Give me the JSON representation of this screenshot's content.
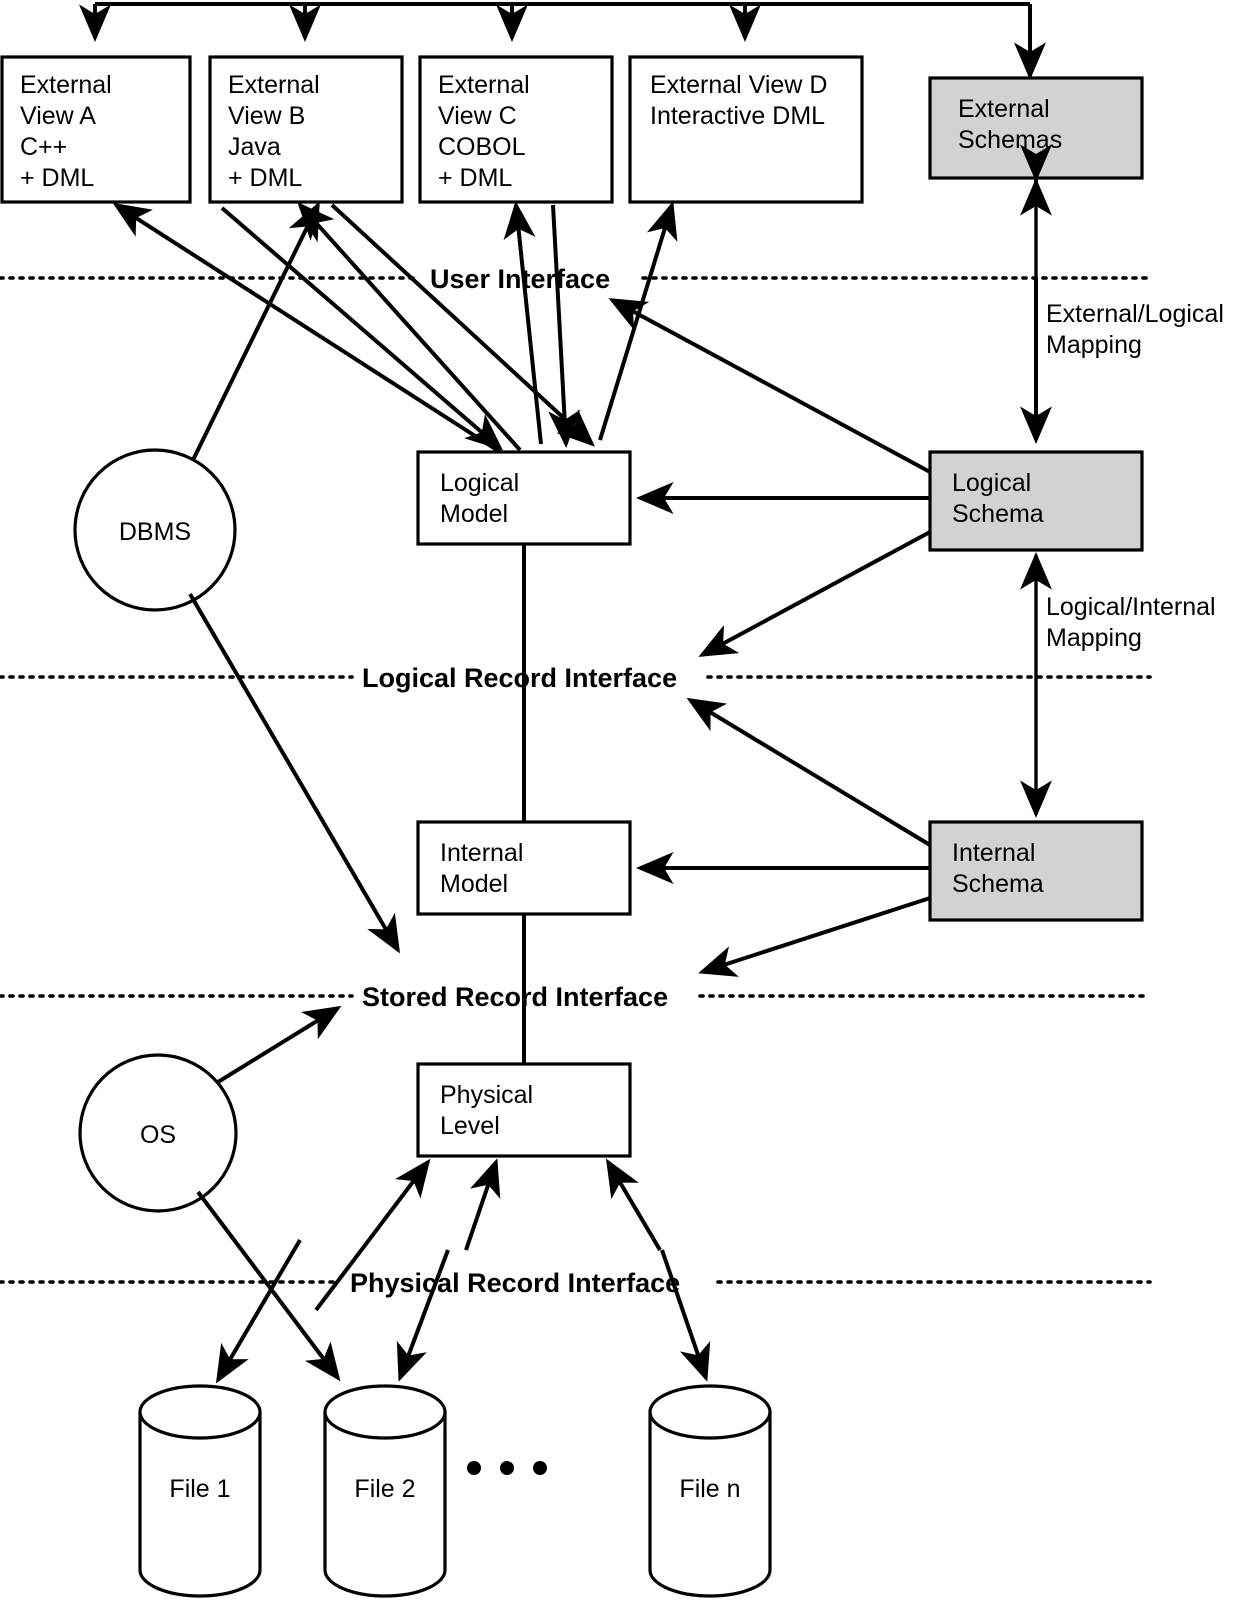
{
  "diagram": {
    "title": "Three-Level Database Architecture (ANSI/SPARC)",
    "colors": {
      "schema_fill": "#d2d2d2",
      "node_fill": "#ffffff",
      "stroke": "#000000"
    },
    "external_views": [
      {
        "id": "view-a",
        "lines": [
          "External",
          "View A",
          "C++",
          "+ DML"
        ]
      },
      {
        "id": "view-b",
        "lines": [
          "External",
          "View B",
          "Java",
          "+ DML"
        ]
      },
      {
        "id": "view-c",
        "lines": [
          "External",
          "View C",
          "COBOL",
          "+ DML"
        ]
      },
      {
        "id": "view-d",
        "lines": [
          "External View D",
          "Interactive DML"
        ]
      }
    ],
    "schemas": [
      {
        "id": "external-schemas",
        "lines": [
          "External",
          "Schemas"
        ]
      },
      {
        "id": "logical-schema",
        "lines": [
          "Logical",
          "Schema"
        ]
      },
      {
        "id": "internal-schema",
        "lines": [
          "Internal",
          "Schema"
        ]
      }
    ],
    "models": [
      {
        "id": "logical-model",
        "lines": [
          "Logical",
          "Model"
        ]
      },
      {
        "id": "internal-model",
        "lines": [
          "Internal",
          "Model"
        ]
      },
      {
        "id": "physical-level",
        "lines": [
          "Physical",
          "Level"
        ]
      }
    ],
    "actors": [
      {
        "id": "dbms",
        "label": "DBMS"
      },
      {
        "id": "os",
        "label": "OS"
      }
    ],
    "interfaces": [
      {
        "id": "user-interface",
        "label": "User Interface"
      },
      {
        "id": "logical-record-interface",
        "label": "Logical Record Interface"
      },
      {
        "id": "stored-record-interface",
        "label": "Stored Record Interface"
      },
      {
        "id": "physical-record-interface",
        "label": "Physical Record Interface"
      }
    ],
    "mappings": [
      {
        "id": "external-logical-mapping",
        "lines": [
          "External/Logical",
          "Mapping"
        ]
      },
      {
        "id": "logical-internal-mapping",
        "lines": [
          "Logical/Internal",
          "Mapping"
        ]
      }
    ],
    "files": [
      {
        "id": "file-1",
        "label": "File 1"
      },
      {
        "id": "file-2",
        "label": "File 2"
      },
      {
        "id": "file-n",
        "label": "File n"
      }
    ],
    "ellipsis": "• • •"
  }
}
